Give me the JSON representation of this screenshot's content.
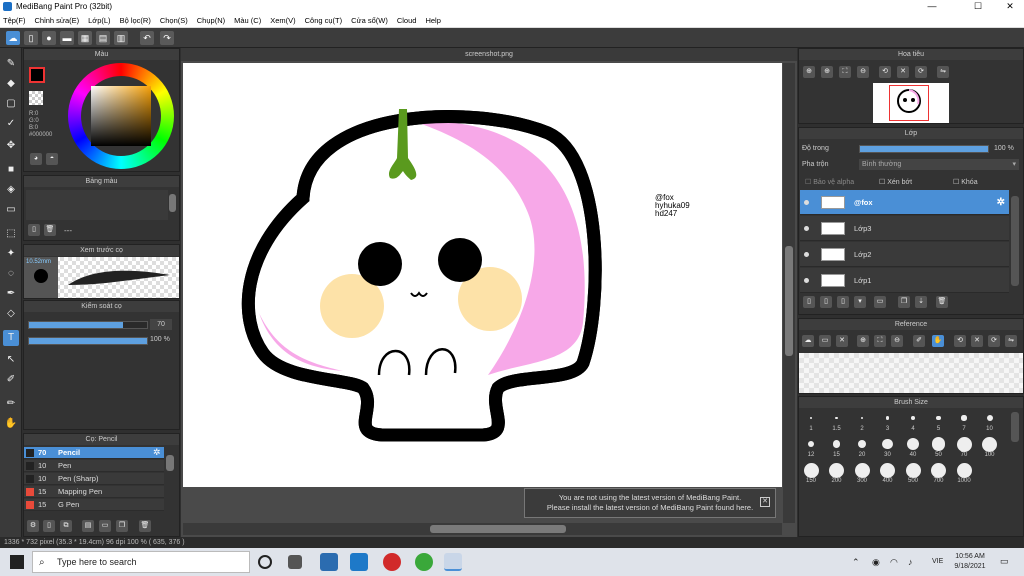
{
  "window": {
    "title": "MediBang Paint Pro (32bit)",
    "minimize": "—",
    "maximize": "☐",
    "close": "✕"
  },
  "menu": [
    "Tệp(F)",
    "Chỉnh sửa(E)",
    "Lớp(L)",
    "Bộ lọc(R)",
    "Chọn(S)",
    "Chụp(N)",
    "Màu (C)",
    "Xem(V)",
    "Công cụ(T)",
    "Cửa sổ(W)",
    "Cloud",
    "Help"
  ],
  "document": {
    "tab": "screenshot.png",
    "watermark": [
      "@fox",
      "hyhuka09",
      "hd247"
    ]
  },
  "color_panel": {
    "title": "Màu",
    "r": "R:0",
    "g": "G:0",
    "b": "B:0",
    "hex": "#000000"
  },
  "palette_panel": {
    "title": "Bảng màu",
    "dash": "---"
  },
  "brush_preview": {
    "title": "Xem trước cọ",
    "size": "10.52mm"
  },
  "brush_control": {
    "title": "Kiểm soát cọ",
    "size_value": "70",
    "opacity_value": "100 %",
    "size_fraction": 0.8,
    "opacity_fraction": 1.0
  },
  "brush_list": {
    "title": "Cọ: Pencil",
    "items": [
      {
        "size": "70",
        "name": "Pencil",
        "color": "#222222",
        "selected": true
      },
      {
        "size": "10",
        "name": "Pen",
        "color": "#222222",
        "selected": false
      },
      {
        "size": "10",
        "name": "Pen (Sharp)",
        "color": "#222222",
        "selected": false
      },
      {
        "size": "15",
        "name": "Mapping Pen",
        "color": "#e84a3a",
        "selected": false
      },
      {
        "size": "15",
        "name": "G Pen",
        "color": "#e84a3a",
        "selected": false
      }
    ]
  },
  "navigator": {
    "title": "Hoa tiêu"
  },
  "layer_panel": {
    "title": "Lớp",
    "opacity_label": "Độ trong",
    "opacity_value": "100 %",
    "opacity_fraction": 1.0,
    "blend_label": "Pha trộn",
    "blend_value": "Bình thường",
    "protect_alpha": "Bảo vệ alpha",
    "clipping": "Xén bớt",
    "lock": "Khóa",
    "layers": [
      {
        "name": "@fox",
        "selected": true
      },
      {
        "name": "Lớp3",
        "selected": false
      },
      {
        "name": "Lớp2",
        "selected": false
      },
      {
        "name": "Lớp1",
        "selected": false
      }
    ]
  },
  "reference_panel": {
    "title": "Reference"
  },
  "brush_size_panel": {
    "title": "Brush Size",
    "sizes": [
      "1",
      "1.5",
      "2",
      "3",
      "4",
      "5",
      "7",
      "10",
      "12",
      "15",
      "20",
      "30",
      "40",
      "50",
      "70",
      "100",
      "150",
      "200",
      "300",
      "400",
      "500",
      "700",
      "1000"
    ]
  },
  "notice": {
    "line1": "You are not using the latest version of MediBang Paint.",
    "line2": "Please install the latest version of MediBang Paint found here.",
    "close": "✕"
  },
  "status": "1336 * 732 pixel   (35.3 * 19.4cm)   96 dpi   100 %   ( 635, 376 )",
  "taskbar": {
    "search_placeholder": "Type here to search",
    "lang": "VIE",
    "time": "10:56 AM",
    "date": "9/18/2021"
  },
  "colors": {
    "accent": "#4a8fd6",
    "pink": "#f7a8e8",
    "cheek": "#fde2a8",
    "sprout": "#5a9a1e"
  }
}
